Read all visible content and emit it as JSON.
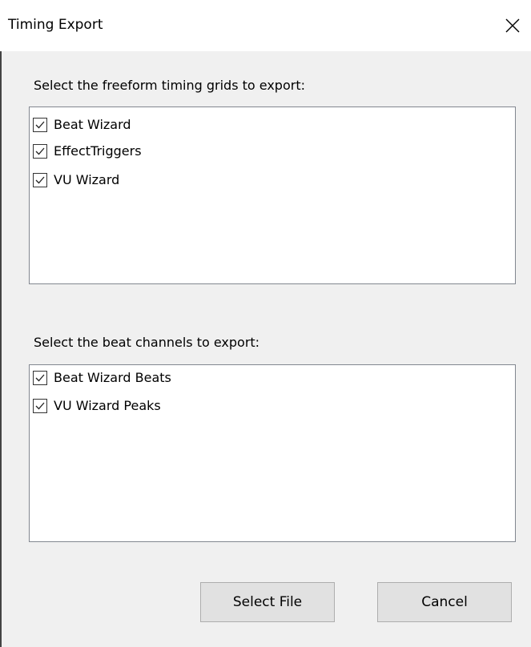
{
  "window": {
    "title": "Timing Export",
    "close_icon": "close-icon"
  },
  "grids_section": {
    "label": "Select the freeform timing grids to export:",
    "items": [
      {
        "label": "Beat Wizard",
        "checked": true
      },
      {
        "label": "EffectTriggers",
        "checked": true
      },
      {
        "label": "VU Wizard",
        "checked": true
      }
    ]
  },
  "beats_section": {
    "label": "Select the beat channels to export:",
    "items": [
      {
        "label": "Beat Wizard Beats",
        "checked": true
      },
      {
        "label": "VU Wizard Peaks",
        "checked": true
      }
    ]
  },
  "buttons": {
    "select_file": "Select File",
    "cancel": "Cancel"
  }
}
